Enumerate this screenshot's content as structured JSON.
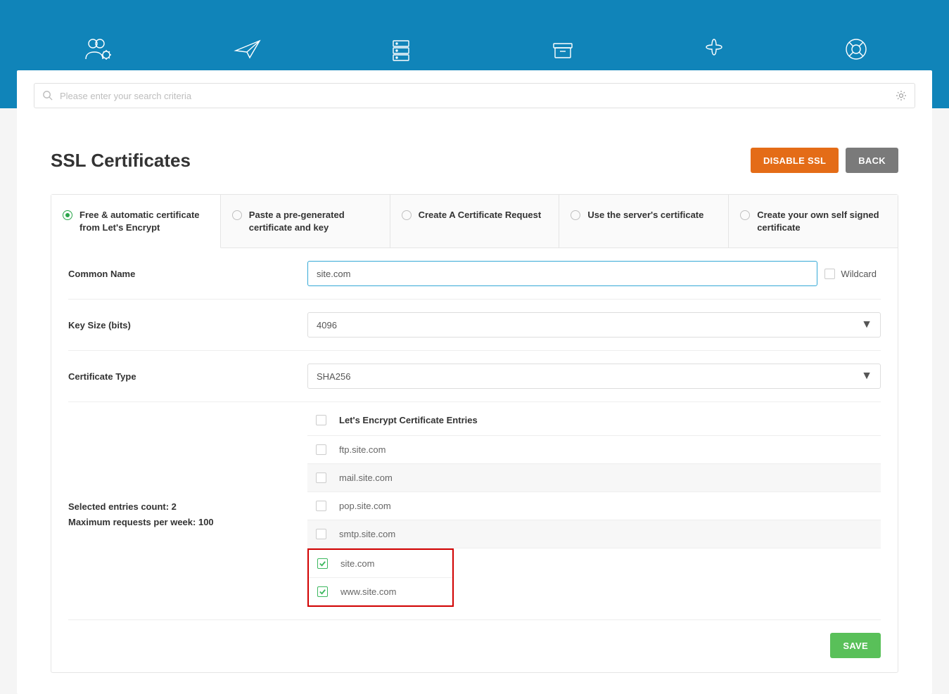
{
  "topnav": [
    {
      "label": "Account Manager"
    },
    {
      "label": "E-mail Manager"
    },
    {
      "label": "Advanced Features"
    },
    {
      "label": "System Info & Files"
    },
    {
      "label": "Extra Features"
    },
    {
      "label": "Support & Help"
    }
  ],
  "search": {
    "placeholder": "Please enter your search criteria"
  },
  "page": {
    "title": "SSL Certificates",
    "disable_ssl": "DISABLE SSL",
    "back": "BACK",
    "save": "SAVE"
  },
  "tabs": [
    {
      "label": "Free & automatic certificate from Let's Encrypt",
      "active": true
    },
    {
      "label": "Paste a pre-generated certificate and key",
      "active": false
    },
    {
      "label": "Create A Certificate Request",
      "active": false
    },
    {
      "label": "Use the server's certificate",
      "active": false
    },
    {
      "label": "Create your own self signed certificate",
      "active": false
    }
  ],
  "form": {
    "common_name_label": "Common Name",
    "common_name_value": "site.com",
    "wildcard_label": "Wildcard",
    "wildcard_checked": false,
    "key_size_label": "Key Size (bits)",
    "key_size_value": "4096",
    "cert_type_label": "Certificate Type",
    "cert_type_value": "SHA256",
    "entries_header": "Let's Encrypt Certificate Entries",
    "entries": [
      {
        "name": "ftp.site.com",
        "checked": false
      },
      {
        "name": "mail.site.com",
        "checked": false
      },
      {
        "name": "pop.site.com",
        "checked": false
      },
      {
        "name": "smtp.site.com",
        "checked": false
      },
      {
        "name": "site.com",
        "checked": true
      },
      {
        "name": "www.site.com",
        "checked": true
      }
    ],
    "selected_count_label": "Selected entries count: 2",
    "max_requests_label": "Maximum requests per week: 100"
  }
}
